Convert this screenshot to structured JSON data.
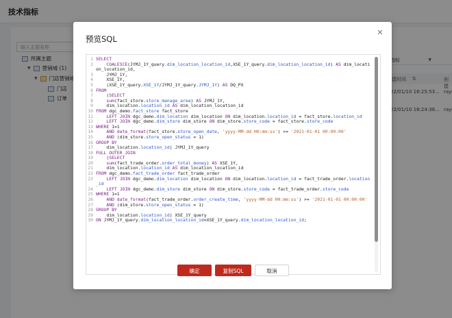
{
  "page": {
    "title": "技术指标",
    "search_placeholder": "输入主题名称",
    "tree": [
      {
        "label": "所属主题",
        "level": 0
      },
      {
        "label": "营销域 (1)",
        "level": 1
      },
      {
        "label": "门店营销域",
        "level": 2
      },
      {
        "label": "门店",
        "level": 3
      },
      {
        "label": "订单",
        "level": 3
      }
    ],
    "right_select": "指标",
    "columns": [
      "建时间",
      "创建"
    ],
    "rows": [
      {
        "time": "22/01/10 16:25:53...",
        "user": "rayo"
      },
      {
        "time": "22/01/10 16:24:38...",
        "user": "rayo"
      }
    ]
  },
  "modal": {
    "title": "预览SQL",
    "close_icon": "close-icon",
    "confirm_label": "确定",
    "copy_label": "复制SQL",
    "cancel_label": "取消"
  },
  "colors": {
    "primary": "#bf2a1f",
    "keyword": "#7d1d8a",
    "field": "#2f55c6",
    "string": "#b0602c"
  },
  "sql_lines": [
    {
      "n": "1",
      "text": "SELECT"
    },
    {
      "n": "2",
      "text": "    COALESCE(JYMJ_1Y_query.dim_location_location_id,XSE_1Y_query.dim_location_location_id) AS dim_location_location_id,"
    },
    {
      "n": "3",
      "text": "    JYMJ_1Y,"
    },
    {
      "n": "4",
      "text": "    XSE_1Y,"
    },
    {
      "n": "5",
      "text": "    (XSE_1Y_query.XSE_1Y/JYMJ_1Y_query.JYMJ_1Y) AS DQ_PX"
    },
    {
      "n": "6",
      "text": "FROM"
    },
    {
      "n": "7",
      "text": "    (SELECT"
    },
    {
      "n": "8",
      "text": "    sum(fact_store.store_manage_area) AS JYMJ_1Y,"
    },
    {
      "n": "9",
      "text": "    dim_location.location_id AS dim_location_location_id"
    },
    {
      "n": "10",
      "text": "FROM dgc_demo.fact_store fact_store"
    },
    {
      "n": "11",
      "text": "    LEFT JOIN dgc_demo.dim_location dim_location ON dim_location.location_id = fact_store.location_id"
    },
    {
      "n": "12",
      "text": "    LEFT JOIN dgc_demo.dim_store dim_store ON dim_store.store_code = fact_store.store_code"
    },
    {
      "n": "13",
      "text": "WHERE 1=1"
    },
    {
      "n": "14",
      "text": "    AND date_format(fact_store.store_open_date, 'yyyy-MM-dd HH:mm:ss') >= '2021-01-01 00:00:00'"
    },
    {
      "n": "15",
      "text": "    AND (dim_store.store_open_status = 1)"
    },
    {
      "n": "16",
      "text": "GROUP BY"
    },
    {
      "n": "17",
      "text": "    dim_location.location_id) JYMJ_1Y_query"
    },
    {
      "n": "18",
      "text": "FULL OUTER JOIN"
    },
    {
      "n": "19",
      "text": "    (SELECT"
    },
    {
      "n": "20",
      "text": "    sum(fact_trade_order.order_total_money) AS XSE_1Y,"
    },
    {
      "n": "21",
      "text": "    dim_location.location_id AS dim_location_location_id"
    },
    {
      "n": "22",
      "text": "FROM dgc_demo.fact_trade_order fact_trade_order"
    },
    {
      "n": "23",
      "text": "    LEFT JOIN dgc_demo.dim_location dim_location ON dim_location.location_id = fact_trade_order.location_id"
    },
    {
      "n": "24",
      "text": "    LEFT JOIN dgc_demo.dim_store dim_store ON dim_store.store_code = fact_trade_order.store_code"
    },
    {
      "n": "25",
      "text": "WHERE 1=1"
    },
    {
      "n": "26",
      "text": "    AND date_format(fact_trade_order.order_create_time, 'yyyy-MM-dd HH:mm:ss') >= '2021-01-01 00:00:00'"
    },
    {
      "n": "27",
      "text": "    AND (dim_store.store_open_status = 1)"
    },
    {
      "n": "28",
      "text": "GROUP BY"
    },
    {
      "n": "29",
      "text": "    dim_location.location_id) XSE_1Y_query"
    },
    {
      "n": "30",
      "text": "ON JYMJ_1Y_query.dim_location_location_id=XSE_1Y_query.dim_location_location_id;"
    }
  ]
}
